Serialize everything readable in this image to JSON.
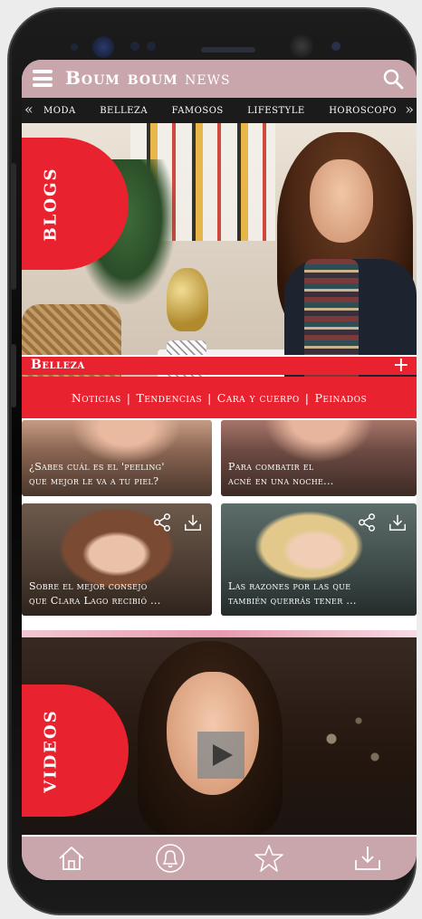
{
  "header": {
    "brand_bold": "Boum boum",
    "brand_light": "news"
  },
  "categories": [
    "MODA",
    "BELLEZA",
    "FAMOSOS",
    "LIFESTYLE",
    "HOROSCOPO"
  ],
  "hero": {
    "badge": "BLOGS"
  },
  "section": {
    "title": "Belleza",
    "tabs": [
      "Noticias",
      "Tendencias",
      "Cara y cuerpo",
      "Peinados"
    ]
  },
  "cards": [
    {
      "title_line1": "¿Sabes cuál es el 'peeling'",
      "title_line2": "que mejor le va a tu piel?"
    },
    {
      "title_line1": "Para combatir el",
      "title_line2": "acné en una noche..."
    },
    {
      "title_line1": "Sobre el mejor consejo",
      "title_line2": "que Clara Lago  recibió ..."
    },
    {
      "title_line1": "Las razones por las que",
      "title_line2": "también querrás tener ..."
    }
  ],
  "videos": {
    "badge": "VIDEOS"
  },
  "colors": {
    "accent_red": "#e8232f",
    "header_pink": "#c9a5ac",
    "nav_dark": "#1b1b1b"
  },
  "icons": [
    "hamburger-icon",
    "search-icon",
    "share-icon",
    "download-icon",
    "home-icon",
    "bell-icon",
    "star-icon",
    "play-icon"
  ]
}
